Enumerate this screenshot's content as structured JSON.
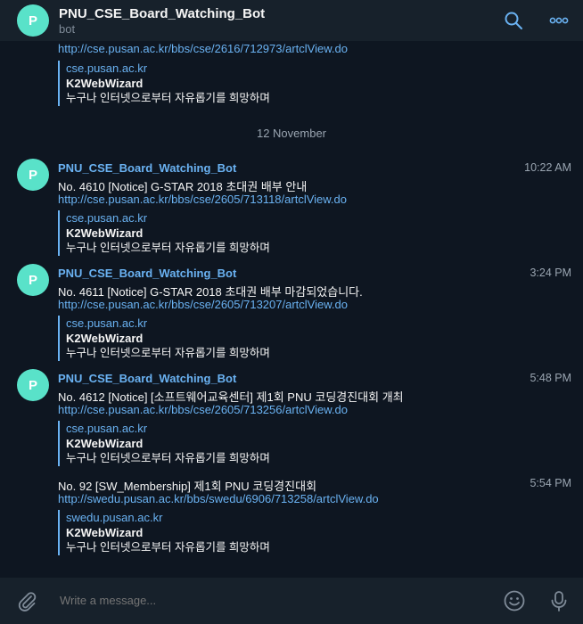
{
  "header": {
    "avatar_letter": "P",
    "title": "PNU_CSE_Board_Watching_Bot",
    "subtitle": "bot"
  },
  "chat": {
    "top_fragment": {
      "link": "http://cse.pusan.ac.kr/bbs/cse/2616/712973/artclView.do",
      "preview": {
        "site": "cse.pusan.ac.kr",
        "title": "K2WebWizard",
        "desc": "누구나 인터넷으로부터 자유롭기를 희망하며"
      }
    },
    "date_separator": "12 November",
    "messages": [
      {
        "avatar_letter": "P",
        "sender": "PNU_CSE_Board_Watching_Bot",
        "time": "10:22 AM",
        "text": "No. 4610 [Notice] G-STAR 2018 초대권 배부 안내",
        "link": "http://cse.pusan.ac.kr/bbs/cse/2605/713118/artclView.do",
        "preview": {
          "site": "cse.pusan.ac.kr",
          "title": "K2WebWizard",
          "desc": "누구나 인터넷으로부터 자유롭기를 희망하며"
        }
      },
      {
        "avatar_letter": "P",
        "sender": "PNU_CSE_Board_Watching_Bot",
        "time": "3:24 PM",
        "text": "No. 4611 [Notice] G-STAR 2018 초대권 배부 마감되었습니다.",
        "link": "http://cse.pusan.ac.kr/bbs/cse/2605/713207/artclView.do",
        "preview": {
          "site": "cse.pusan.ac.kr",
          "title": "K2WebWizard",
          "desc": "누구나 인터넷으로부터 자유롭기를 희망하며"
        }
      },
      {
        "avatar_letter": "P",
        "sender": "PNU_CSE_Board_Watching_Bot",
        "time": "5:48 PM",
        "text": "No. 4612 [Notice] [소프트웨어교육센터] 제1회 PNU 코딩경진대회 개최",
        "link": "http://cse.pusan.ac.kr/bbs/cse/2605/713256/artclView.do",
        "preview": {
          "site": "cse.pusan.ac.kr",
          "title": "K2WebWizard",
          "desc": "누구나 인터넷으로부터 자유롭기를 희망하며"
        }
      },
      {
        "time": "5:54 PM",
        "text": "No. 92 [SW_Membership] 제1회 PNU 코딩경진대회",
        "link": "http://swedu.pusan.ac.kr/bbs/swedu/6906/713258/artclView.do",
        "preview": {
          "site": "swedu.pusan.ac.kr",
          "title": "K2WebWizard",
          "desc": "누구나 인터넷으로부터 자유롭기를 희망하며"
        }
      }
    ]
  },
  "footer": {
    "placeholder": "Write a message..."
  },
  "icons": [
    "search-icon",
    "more-icon",
    "attach-icon",
    "emoji-icon",
    "microphone-icon"
  ],
  "colors": {
    "accent": "#6ab2f2",
    "avatar": "#59e2c9",
    "background": "#0e1621",
    "panel": "#17212b"
  }
}
